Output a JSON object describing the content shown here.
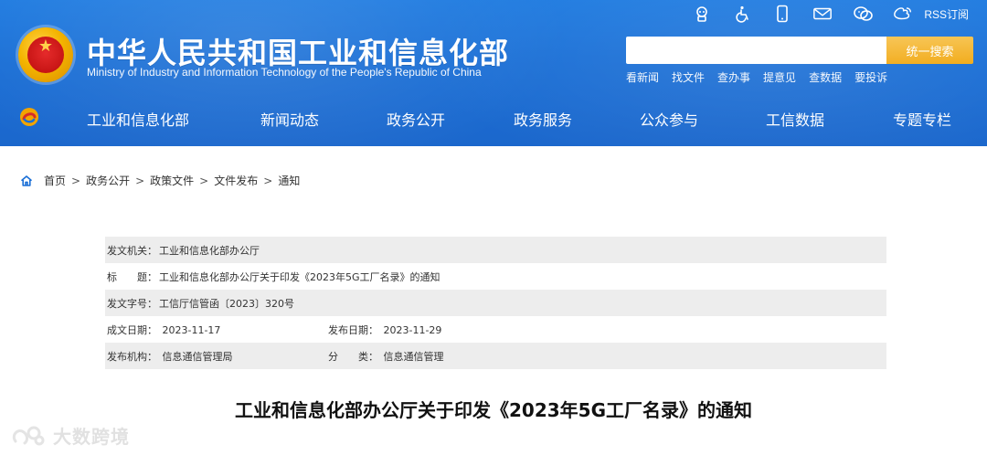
{
  "header": {
    "site_title": "中华人民共和国工业和信息化部",
    "site_subtitle": "Ministry of Industry and Information Technology of the People's Republic of China",
    "top_icons": [
      "accessibility-robot-icon",
      "wheelchair-icon",
      "mobile-icon",
      "mail-icon",
      "wechat-icon",
      "weibo-icon"
    ],
    "rss_label": "RSS订阅",
    "search": {
      "placeholder": "",
      "button_label": "统一搜索"
    },
    "quick_links": [
      "看新闻",
      "找文件",
      "查办事",
      "提意见",
      "查数据",
      "要投诉"
    ],
    "nav": [
      {
        "label": "工业和信息化部"
      },
      {
        "label": "新闻动态"
      },
      {
        "label": "政务公开"
      },
      {
        "label": "政务服务"
      },
      {
        "label": "公众参与"
      },
      {
        "label": "工信数据"
      },
      {
        "label": "专题专栏"
      }
    ],
    "colors": {
      "header_blue": "#1a6fd6",
      "search_button": "#f1a914"
    }
  },
  "breadcrumb": {
    "items": [
      "首页",
      "政务公开",
      "政策文件",
      "文件发布",
      "通知"
    ],
    "separator": ">"
  },
  "info": {
    "issuer": {
      "label": "发文机关：",
      "value": "工业和信息化部办公厅"
    },
    "title": {
      "label": "标　　题：",
      "value": "工业和信息化部办公厅关于印发《2023年5G工厂名录》的通知"
    },
    "doc_no": {
      "label": "发文字号：",
      "value": "工信厅信管函〔2023〕320号"
    },
    "date_created": {
      "label": "成文日期：",
      "value": "2023-11-17"
    },
    "date_published": {
      "label": "发布日期：",
      "value": "2023-11-29"
    },
    "org": {
      "label": "发布机构：",
      "value": "信息通信管理局"
    },
    "category": {
      "label": "分　　类：",
      "value": "信息通信管理"
    }
  },
  "article": {
    "title": "工业和信息化部办公厅关于印发《2023年5G工厂名录》的通知"
  },
  "watermark": {
    "text": "大数跨境"
  }
}
